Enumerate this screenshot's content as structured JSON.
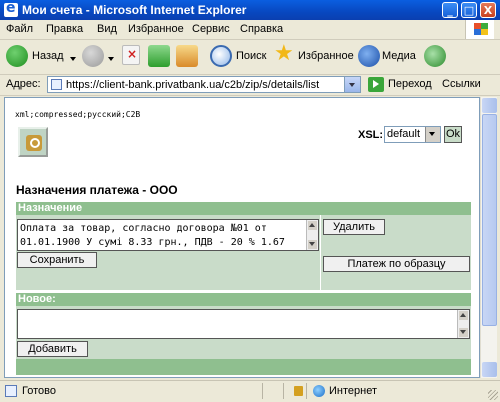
{
  "window": {
    "title": "Мои счета - Microsoft Internet Explorer",
    "controls": [
      "_",
      "□",
      "X"
    ]
  },
  "menu": [
    "Файл",
    "Правка",
    "Вид",
    "Избранное",
    "Сервис",
    "Справка"
  ],
  "toolbar": {
    "back": "Назад",
    "search": "Поиск",
    "favorites": "Избранное",
    "media": "Медиа"
  },
  "address": {
    "label": "Адрес:",
    "url": "https://client-bank.privatbank.ua/c2b/zip/s/details/list",
    "go": "Переход",
    "links": "Ссылки"
  },
  "page": {
    "meta": "xml;compressed;русский;C2B",
    "xsl_label": "XSL:",
    "xsl_value": "default",
    "ok": "Ok",
    "title": "Назначения платежа - ООО",
    "purpose_section": "Назначение",
    "purpose_line1": "Оплата за товар, согласно договора №01 от",
    "purpose_line2": "01.01.1900 У сумі 8.33 грн., ПДВ - 20 % 1.67",
    "save": "Сохранить",
    "delete": "Удалить",
    "template_pay": "Платеж по образцу",
    "new_section": "Новое:",
    "add": "Добавить"
  },
  "status": {
    "text": "Готово",
    "zone": "Интернет"
  },
  "colors": {
    "section_header": "#8fbf8f",
    "section_body": "#c9dcc9",
    "titlebar": "#0a5ee0"
  }
}
